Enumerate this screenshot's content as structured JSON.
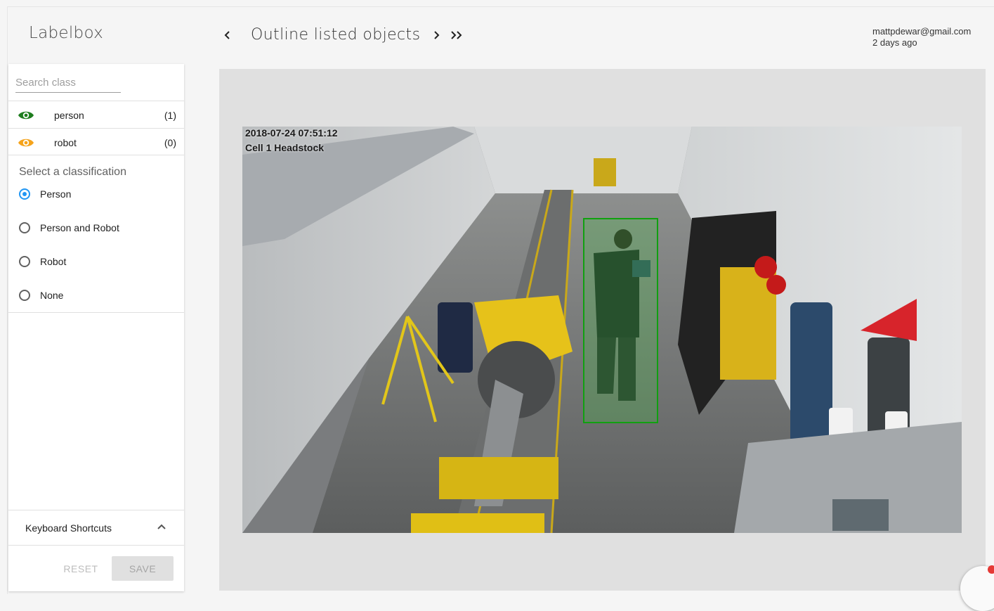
{
  "app": {
    "name": "Labelbox"
  },
  "header": {
    "title": "Outline listed objects",
    "user_email": "mattpdewar@gmail.com",
    "timestamp": "2 days ago"
  },
  "search": {
    "placeholder": "Search class",
    "value": ""
  },
  "classes": [
    {
      "label": "person",
      "count": "(1)",
      "color": "#1e7d1e"
    },
    {
      "label": "robot",
      "count": "(0)",
      "color": "#f5a31a"
    }
  ],
  "classification": {
    "title": "Select a classification",
    "selected": "Person",
    "options": [
      "Person",
      "Person and Robot",
      "Robot",
      "None"
    ]
  },
  "shortcuts": {
    "label": "Keyboard Shortcuts"
  },
  "actions": {
    "reset_label": "RESET",
    "save_label": "SAVE"
  },
  "image": {
    "timestamp": "2018-07-24 07:51:12",
    "camera": "Cell 1 Headstock",
    "annotation_class": "person",
    "annotation_color": "#10a010"
  },
  "colors": {
    "accent": "#2196f3"
  }
}
